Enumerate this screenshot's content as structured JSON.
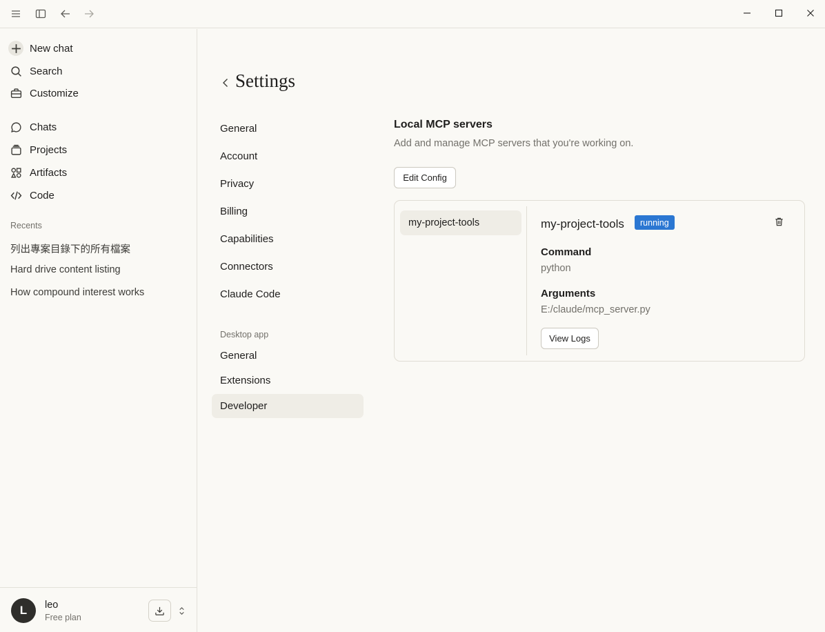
{
  "titlebar": {
    "icons": [
      "menu-icon",
      "sidebar-toggle-icon",
      "back-arrow-icon",
      "forward-arrow-icon"
    ],
    "window_controls": [
      "minimize-icon",
      "maximize-icon",
      "close-icon"
    ]
  },
  "sidebar": {
    "new_chat": "New chat",
    "search": "Search",
    "customize": "Customize",
    "chats": "Chats",
    "projects": "Projects",
    "artifacts": "Artifacts",
    "code": "Code",
    "recents_title": "Recents",
    "recents": [
      "列出專案目錄下的所有檔案",
      "Hard drive content listing",
      "How compound interest works"
    ],
    "user": {
      "initial": "L",
      "name": "leo",
      "plan": "Free plan"
    }
  },
  "settings": {
    "title": "Settings",
    "nav": [
      "General",
      "Account",
      "Privacy",
      "Billing",
      "Capabilities",
      "Connectors",
      "Claude Code"
    ],
    "desktop_label": "Desktop app",
    "desktop_nav": [
      "General",
      "Extensions",
      "Developer"
    ],
    "active_item": "Developer"
  },
  "mcp": {
    "title": "Local MCP servers",
    "subtitle": "Add and manage MCP servers that you're working on.",
    "edit_config": "Edit Config",
    "servers": [
      "my-project-tools"
    ],
    "selected": {
      "name": "my-project-tools",
      "status": "running",
      "status_color": "#2b77d2",
      "command_label": "Command",
      "command": "python",
      "arguments_label": "Arguments",
      "arguments": "E:/claude/mcp_server.py",
      "view_logs": "View Logs"
    }
  }
}
